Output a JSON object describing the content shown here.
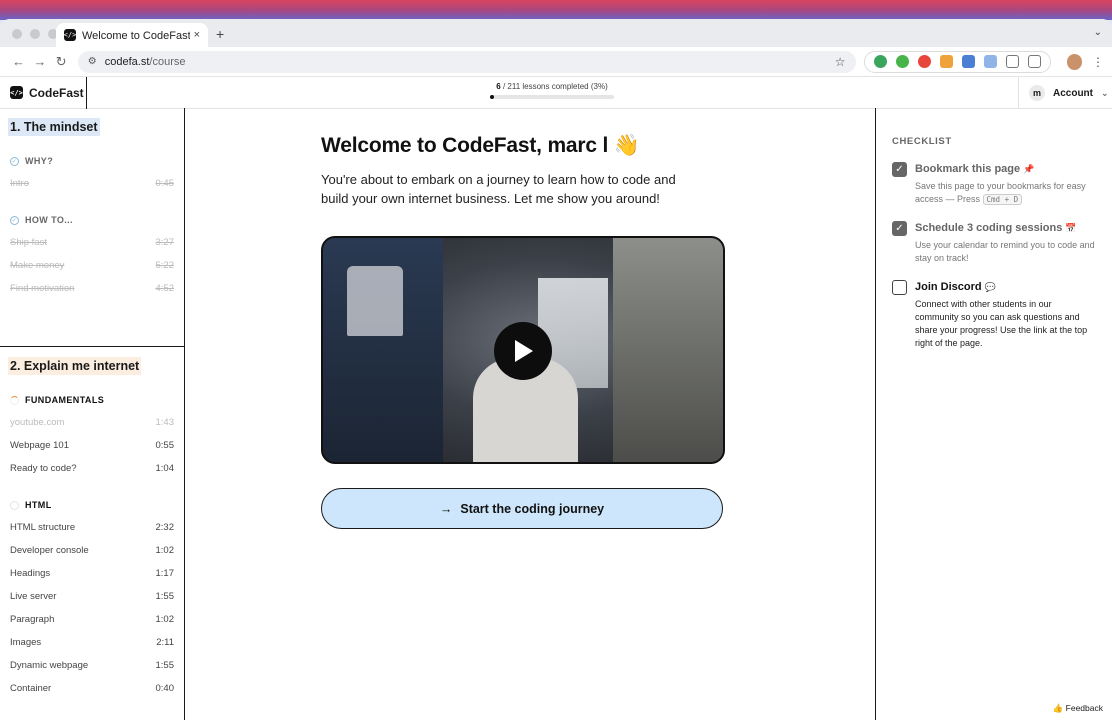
{
  "browser": {
    "tab_title": "Welcome to CodeFast 🎉",
    "tab_close": "×",
    "new_tab": "+",
    "url_host": "codefa.st",
    "url_path": "/course"
  },
  "app": {
    "brand": "CodeFast",
    "progress": {
      "done": "6",
      "rest": " / 211 lessons completed (3%)",
      "fraction": 0.03
    },
    "account": {
      "initial": "m",
      "label": "Account"
    }
  },
  "sidebar": {
    "modules": [
      {
        "title": "1. The mindset",
        "sections": [
          {
            "name": "WHY?",
            "lessons": [
              {
                "title": "Intro",
                "duration": "0:45"
              }
            ]
          },
          {
            "name": "HOW TO...",
            "lessons": [
              {
                "title": "Ship fast",
                "duration": "3:27"
              },
              {
                "title": "Make money",
                "duration": "5:22"
              },
              {
                "title": "Find motivation",
                "duration": "4:52"
              }
            ]
          }
        ]
      },
      {
        "title": "2. Explain me internet",
        "sections": [
          {
            "name": "FUNDAMENTALS",
            "lessons": [
              {
                "title": "youtube.com",
                "duration": "1:43"
              },
              {
                "title": "Webpage 101",
                "duration": "0:55"
              },
              {
                "title": "Ready to code?",
                "duration": "1:04"
              }
            ]
          },
          {
            "name": "HTML",
            "lessons": [
              {
                "title": "HTML structure",
                "duration": "2:32"
              },
              {
                "title": "Developer console",
                "duration": "1:02"
              },
              {
                "title": "Headings",
                "duration": "1:17"
              },
              {
                "title": "Live server",
                "duration": "1:55"
              },
              {
                "title": "Paragraph",
                "duration": "1:02"
              },
              {
                "title": "Images",
                "duration": "2:11"
              },
              {
                "title": "Dynamic webpage",
                "duration": "1:55"
              },
              {
                "title": "Container",
                "duration": "0:40"
              }
            ]
          }
        ]
      }
    ]
  },
  "main": {
    "heading": "Welcome to CodeFast, marc l 👋",
    "intro": "You're about to embark on a journey to learn how to code and build your own internet business. Let me show you around!",
    "cta_arrow": "→",
    "cta": "Start the coding journey"
  },
  "checklist": {
    "title": "CHECKLIST",
    "items": [
      {
        "title": "Bookmark this page",
        "emoji": "📌",
        "desc_before": "Save this page to your bookmarks for easy access — Press ",
        "kbd": "Cmd + D",
        "desc": ""
      },
      {
        "title": "Schedule 3 coding sessions",
        "emoji": "📅",
        "desc": "Use your calendar to remind you to code and stay on track!"
      },
      {
        "title": "Join Discord",
        "emoji": "💬",
        "desc": "Connect with other students in our community so you can ask questions and share your progress! Use the link at the top right of the page."
      }
    ],
    "feedback": "Feedback"
  },
  "icons": {
    "check": "✓",
    "star": "☆",
    "back": "←",
    "forward": "→",
    "reload": "↻",
    "chevron": "⌄",
    "feedback": "👍"
  },
  "colors": {
    "accent_blue": "#cde6fb",
    "module1_highlight": "#dde8f6",
    "module2_highlight": "#fbeee0",
    "spinner_orange": "#e48a2a"
  }
}
